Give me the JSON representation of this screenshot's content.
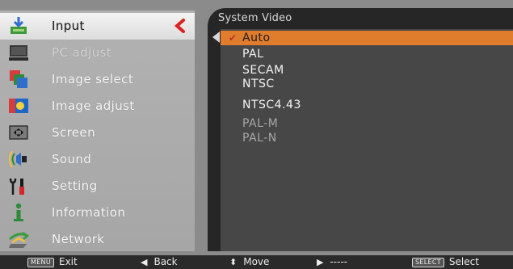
{
  "menu": {
    "items": [
      {
        "label": "Input",
        "icon": "input-icon"
      },
      {
        "label": "PC adjust",
        "icon": "pc-adjust-icon"
      },
      {
        "label": "Image select",
        "icon": "image-select-icon"
      },
      {
        "label": "Image adjust",
        "icon": "image-adjust-icon"
      },
      {
        "label": "Screen",
        "icon": "screen-icon"
      },
      {
        "label": "Sound",
        "icon": "sound-icon"
      },
      {
        "label": "Setting",
        "icon": "setting-icon"
      },
      {
        "label": "Information",
        "icon": "information-icon"
      },
      {
        "label": "Network",
        "icon": "network-icon"
      }
    ],
    "selected_index": 0
  },
  "submenu": {
    "title": "System Video",
    "options": [
      {
        "label": "Auto",
        "selected": true,
        "enabled": true
      },
      {
        "label": "PAL",
        "selected": false,
        "enabled": true
      },
      {
        "label": "SECAM",
        "selected": false,
        "enabled": true
      },
      {
        "label": "NTSC",
        "selected": false,
        "enabled": true
      },
      {
        "label": "NTSC4.43",
        "selected": false,
        "enabled": true
      },
      {
        "label": "PAL-M",
        "selected": false,
        "enabled": false
      },
      {
        "label": "PAL-N",
        "selected": false,
        "enabled": false
      }
    ]
  },
  "hints": {
    "exit_key": "MENU",
    "exit_label": "Exit",
    "back_label": "Back",
    "move_label": "Move",
    "right_label": "-----",
    "select_key": "SELECT",
    "select_label": "Select"
  },
  "colors": {
    "highlight": "#df7d2c",
    "selector_arrow": "#e02020",
    "check_mark": "#c0302a"
  }
}
